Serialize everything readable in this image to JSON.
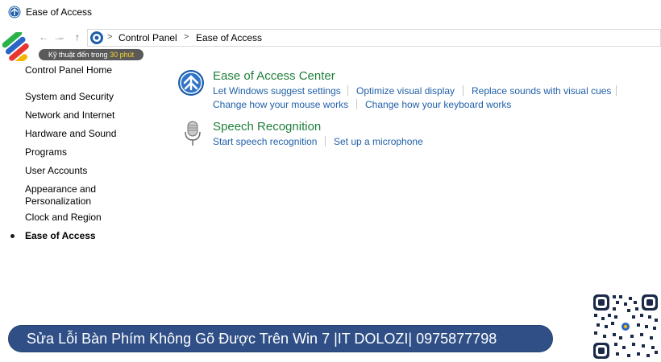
{
  "window": {
    "title": "Ease of Access"
  },
  "address": {
    "breadcrumbs": [
      "Control Panel",
      "Ease of Access"
    ],
    "separator": ">"
  },
  "watermark": {
    "tag_prefix": "Kỹ thuật đến trong",
    "tag_highlight": "30 phút"
  },
  "sidebar": {
    "items": [
      {
        "label": "Control Panel Home"
      },
      {
        "label": "System and Security"
      },
      {
        "label": "Network and Internet"
      },
      {
        "label": "Hardware and Sound"
      },
      {
        "label": "Programs"
      },
      {
        "label": "User Accounts"
      },
      {
        "label": "Appearance and Personalization"
      },
      {
        "label": "Clock and Region"
      },
      {
        "label": "Ease of Access"
      }
    ]
  },
  "categories": {
    "ease_center": {
      "title": "Ease of Access Center",
      "links": [
        "Let Windows suggest settings",
        "Optimize visual display",
        "Replace sounds with visual cues",
        "Change how your mouse works",
        "Change how your keyboard works"
      ]
    },
    "speech": {
      "title": "Speech Recognition",
      "links": [
        "Start speech recognition",
        "Set up a microphone"
      ]
    }
  },
  "banner": {
    "text": "Sửa Lỗi Bàn Phím Không Gõ Được Trên Win 7 |IT DOLOZI| 0975877798"
  },
  "colors": {
    "category_title": "#1e7f3a",
    "link": "#1f5fa8",
    "banner_bg": "#2f4f86",
    "logo_tag_bg": "#5a5a5a",
    "logo_tag_highlight": "#f6d32d"
  },
  "icons": {
    "title": "ease-of-access-icon",
    "address": "control-panel-icon",
    "ease_center": "ease-of-access-center-icon",
    "speech": "microphone-icon",
    "back": "back-arrow-icon",
    "forward": "forward-arrow-icon",
    "recent": "chevron-down-icon",
    "up": "up-arrow-icon"
  }
}
